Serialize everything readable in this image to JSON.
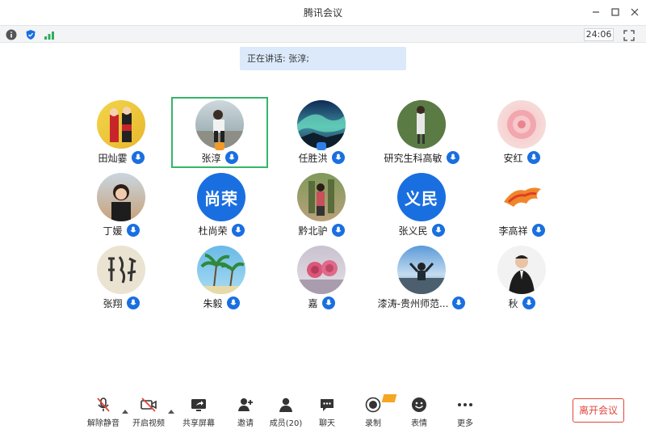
{
  "window": {
    "title": "腾讯会议"
  },
  "statusbar": {
    "timer": "24:06"
  },
  "speaking": {
    "label": "正在讲话: 张淳;"
  },
  "participants": [
    {
      "name": "田灿霎",
      "avatar_text": ""
    },
    {
      "name": "张淳",
      "avatar_text": ""
    },
    {
      "name": "任胜洪",
      "avatar_text": ""
    },
    {
      "name": "研究生科高敏",
      "avatar_text": ""
    },
    {
      "name": "安红",
      "avatar_text": ""
    },
    {
      "name": "丁媛",
      "avatar_text": ""
    },
    {
      "name": "杜尚荣",
      "avatar_text": "尚荣"
    },
    {
      "name": "黔北驴",
      "avatar_text": ""
    },
    {
      "name": "张义民",
      "avatar_text": "义民"
    },
    {
      "name": "李高祥",
      "avatar_text": ""
    },
    {
      "name": "张翔",
      "avatar_text": ""
    },
    {
      "name": "朱毅",
      "avatar_text": ""
    },
    {
      "name": "嘉",
      "avatar_text": ""
    },
    {
      "name": "漆涛-贵州师范...",
      "avatar_text": ""
    },
    {
      "name": "秋",
      "avatar_text": ""
    }
  ],
  "toolbar": {
    "unmute": "解除静音",
    "start_video": "开启视频",
    "share_screen": "共享屏幕",
    "invite": "邀请",
    "members": "成员(20)",
    "chat": "聊天",
    "record": "录制",
    "reactions": "表情",
    "more": "更多",
    "leave": "离开会议"
  },
  "colors": {
    "accent": "#1a6fe0",
    "active_border": "#36b56a",
    "leave": "#e0463b"
  }
}
